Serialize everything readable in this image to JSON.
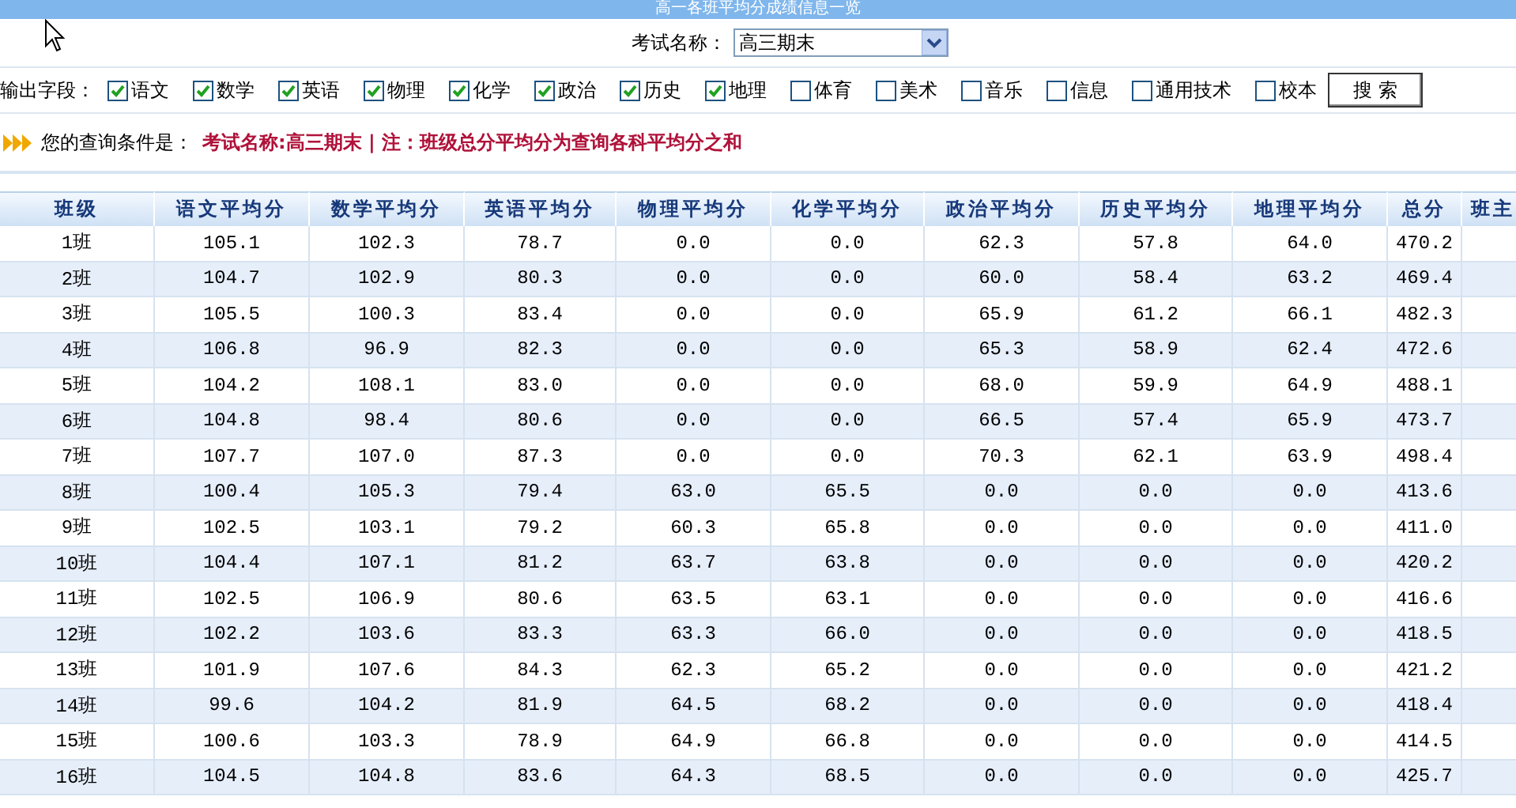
{
  "page_title": "高一各班平均分成绩信息一览",
  "exam": {
    "label": "考试名称：",
    "value": "高三期末"
  },
  "fields": {
    "label": "输出字段：",
    "options": [
      {
        "label": "语文",
        "checked": true
      },
      {
        "label": "数学",
        "checked": true
      },
      {
        "label": "英语",
        "checked": true
      },
      {
        "label": "物理",
        "checked": true
      },
      {
        "label": "化学",
        "checked": true
      },
      {
        "label": "政治",
        "checked": true
      },
      {
        "label": "历史",
        "checked": true
      },
      {
        "label": "地理",
        "checked": true
      },
      {
        "label": "体育",
        "checked": false
      },
      {
        "label": "美术",
        "checked": false
      },
      {
        "label": "音乐",
        "checked": false
      },
      {
        "label": "信息",
        "checked": false
      },
      {
        "label": "通用技术",
        "checked": false
      },
      {
        "label": "校本",
        "checked": false
      }
    ],
    "button": "搜 索"
  },
  "condition": {
    "label": "您的查询条件是：",
    "text": "考试名称:高三期末 | 注：班级总分平均分为查询各科平均分之和"
  },
  "table": {
    "columns": [
      "班级",
      "语文平均分",
      "数学平均分",
      "英语平均分",
      "物理平均分",
      "化学平均分",
      "政治平均分",
      "历史平均分",
      "地理平均分",
      "总分",
      "班主"
    ],
    "rows": [
      [
        "1班",
        "105.1",
        "102.3",
        "78.7",
        "0.0",
        "0.0",
        "62.3",
        "57.8",
        "64.0",
        "470.2"
      ],
      [
        "2班",
        "104.7",
        "102.9",
        "80.3",
        "0.0",
        "0.0",
        "60.0",
        "58.4",
        "63.2",
        "469.4"
      ],
      [
        "3班",
        "105.5",
        "100.3",
        "83.4",
        "0.0",
        "0.0",
        "65.9",
        "61.2",
        "66.1",
        "482.3"
      ],
      [
        "4班",
        "106.8",
        "96.9",
        "82.3",
        "0.0",
        "0.0",
        "65.3",
        "58.9",
        "62.4",
        "472.6"
      ],
      [
        "5班",
        "104.2",
        "108.1",
        "83.0",
        "0.0",
        "0.0",
        "68.0",
        "59.9",
        "64.9",
        "488.1"
      ],
      [
        "6班",
        "104.8",
        "98.4",
        "80.6",
        "0.0",
        "0.0",
        "66.5",
        "57.4",
        "65.9",
        "473.7"
      ],
      [
        "7班",
        "107.7",
        "107.0",
        "87.3",
        "0.0",
        "0.0",
        "70.3",
        "62.1",
        "63.9",
        "498.4"
      ],
      [
        "8班",
        "100.4",
        "105.3",
        "79.4",
        "63.0",
        "65.5",
        "0.0",
        "0.0",
        "0.0",
        "413.6"
      ],
      [
        "9班",
        "102.5",
        "103.1",
        "79.2",
        "60.3",
        "65.8",
        "0.0",
        "0.0",
        "0.0",
        "411.0"
      ],
      [
        "10班",
        "104.4",
        "107.1",
        "81.2",
        "63.7",
        "63.8",
        "0.0",
        "0.0",
        "0.0",
        "420.2"
      ],
      [
        "11班",
        "102.5",
        "106.9",
        "80.6",
        "63.5",
        "63.1",
        "0.0",
        "0.0",
        "0.0",
        "416.6"
      ],
      [
        "12班",
        "102.2",
        "103.6",
        "83.3",
        "63.3",
        "66.0",
        "0.0",
        "0.0",
        "0.0",
        "418.5"
      ],
      [
        "13班",
        "101.9",
        "107.6",
        "84.3",
        "62.3",
        "65.2",
        "0.0",
        "0.0",
        "0.0",
        "421.2"
      ],
      [
        "14班",
        "99.6",
        "104.2",
        "81.9",
        "64.5",
        "68.2",
        "0.0",
        "0.0",
        "0.0",
        "418.4"
      ],
      [
        "15班",
        "100.6",
        "103.3",
        "78.9",
        "64.9",
        "66.8",
        "0.0",
        "0.0",
        "0.0",
        "414.5"
      ],
      [
        "16班",
        "104.5",
        "104.8",
        "83.6",
        "64.3",
        "68.5",
        "0.0",
        "0.0",
        "0.0",
        "425.7"
      ]
    ]
  }
}
